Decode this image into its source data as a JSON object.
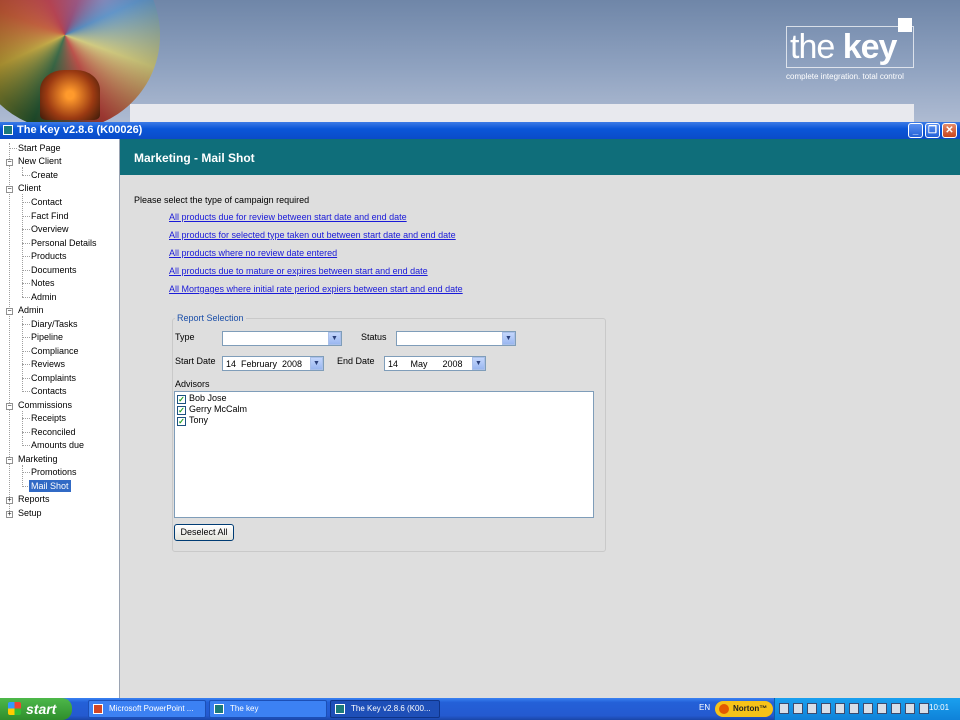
{
  "desktop": {
    "brand_the": "the",
    "brand_key": "key",
    "brand_tagline": "complete integration. total control"
  },
  "window": {
    "title": "The Key v2.8.6 (K00026)",
    "minimize": "_",
    "restore": "❐",
    "close": "✕"
  },
  "tree": {
    "items": [
      {
        "label": "Start Page"
      },
      {
        "label": "New Client"
      },
      {
        "label": "Create"
      },
      {
        "label": "Client"
      },
      {
        "label": "Contact"
      },
      {
        "label": "Fact Find"
      },
      {
        "label": "Overview"
      },
      {
        "label": "Personal Details"
      },
      {
        "label": "Products"
      },
      {
        "label": "Documents"
      },
      {
        "label": "Notes"
      },
      {
        "label": "Admin"
      },
      {
        "label": "Admin"
      },
      {
        "label": "Diary/Tasks"
      },
      {
        "label": "Pipeline"
      },
      {
        "label": "Compliance"
      },
      {
        "label": "Reviews"
      },
      {
        "label": "Complaints"
      },
      {
        "label": "Contacts"
      },
      {
        "label": "Commissions"
      },
      {
        "label": "Receipts"
      },
      {
        "label": "Reconciled"
      },
      {
        "label": "Amounts due"
      },
      {
        "label": "Marketing"
      },
      {
        "label": "Promotions"
      },
      {
        "label": "Mail Shot"
      },
      {
        "label": "Reports"
      },
      {
        "label": "Setup"
      }
    ],
    "expanded_sign": "−",
    "collapsed_sign": "+"
  },
  "main": {
    "header_title": "Marketing - Mail Shot",
    "prompt": "Please select the type of campaign required",
    "campaign_links": [
      "All products due for review between start date and end date",
      "All products for selected type taken out between start date and end date",
      "All products where no review date entered",
      "All products due to mature or expires between start and end date",
      "All Mortgages where initial rate period expiers between start and end date"
    ],
    "report_selection": {
      "legend": "Report Selection",
      "type_label": "Type",
      "type_value": "",
      "status_label": "Status",
      "status_value": "",
      "start_date_label": "Start Date",
      "start_date_value": "14  February  2008",
      "end_date_label": "End Date",
      "end_date_value": "14     May      2008",
      "advisors_label": "Advisors",
      "advisors": [
        {
          "name": "Bob Jose",
          "checked": true
        },
        {
          "name": "Gerry McCalm",
          "checked": true
        },
        {
          "name": "Tony",
          "checked": true
        }
      ],
      "deselect_button": "Deselect All"
    }
  },
  "taskbar": {
    "start_label": "start",
    "tasks": [
      {
        "label": "Microsoft PowerPoint ..."
      },
      {
        "label": "The key"
      },
      {
        "label": "The Key v2.8.6 (K00..."
      }
    ],
    "language": "EN",
    "norton": "Norton™",
    "clock": "10:01"
  },
  "colors": {
    "header_teal": "#0f6e7a",
    "link_blue": "#1a1ad8",
    "legend_blue": "#1a4ea8",
    "selection_blue": "#316ac5"
  }
}
